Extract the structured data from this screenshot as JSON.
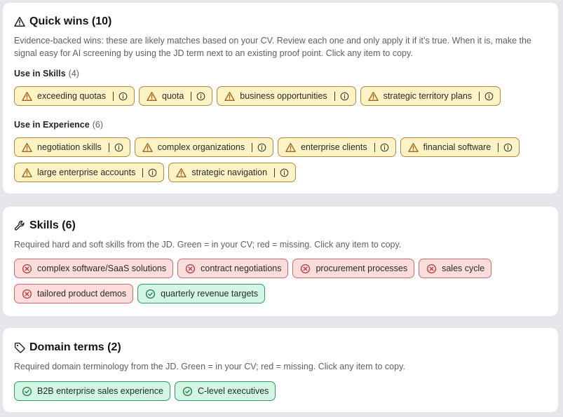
{
  "quick_wins": {
    "title": "Quick wins (10)",
    "description": "Evidence-backed wins: these are likely matches based on your CV. Review each one and only apply it if it’s true. When it is, make the signal easy for AI screening by using the JD term next to an existing proof point. Click any item to copy.",
    "skills_label": "Use in Skills",
    "skills_count": "(4)",
    "skills_items": [
      "exceeding quotas",
      "quota",
      "business opportunities",
      "strategic territory plans"
    ],
    "experience_label": "Use in Experience",
    "experience_count": "(6)",
    "experience_items": [
      "negotiation skills",
      "complex organizations",
      "enterprise clients",
      "financial software",
      "large enterprise accounts",
      "strategic navigation"
    ],
    "icon": "warning-triangle-icon"
  },
  "skills": {
    "title": "Skills (6)",
    "description": "Required hard and soft skills from the JD. Green = in your CV; red = missing. Click any item to copy.",
    "missing_items": [
      "complex software/SaaS solutions",
      "contract negotiations",
      "procurement processes",
      "sales cycle",
      "tailored product demos"
    ],
    "present_items": [
      "quarterly revenue targets"
    ],
    "icon": "wrench-icon"
  },
  "domain_terms": {
    "title": "Domain terms (2)",
    "description": "Required domain terminology from the JD. Green = in your CV; red = missing. Click any item to copy.",
    "present_items": [
      "B2B enterprise sales experience",
      "C-level executives"
    ],
    "icon": "tag-icon"
  },
  "colors": {
    "warn_bg": "#fdf3c4",
    "warn_border": "#b4883a",
    "missing_bg": "#fddcdc",
    "missing_border": "#cf6a6a",
    "present_bg": "#d3f5e4",
    "present_border": "#2f9a62"
  }
}
